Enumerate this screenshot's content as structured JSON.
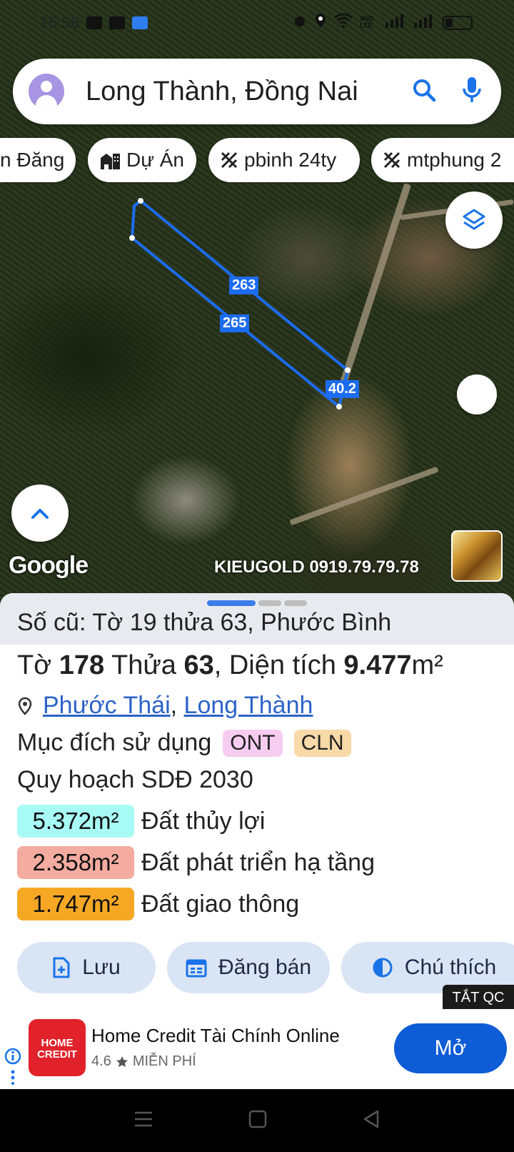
{
  "status_bar": {
    "time": "15:56",
    "network_label": "VoD LTE"
  },
  "search": {
    "query": "Long Thành, Đồng Nai"
  },
  "chips": [
    {
      "label": "n Đăng",
      "icon": ""
    },
    {
      "label": "Dự Án",
      "icon": "buildings-icon"
    },
    {
      "label": "pbinh 24ty",
      "icon": "pattern-icon"
    },
    {
      "label": "mtphung 2",
      "icon": "pattern-icon"
    }
  ],
  "map": {
    "edge_labels": [
      "263",
      "265",
      "40.2"
    ],
    "google_logo": "Google",
    "watermark": "KIEUGOLD 0919.79.79.78",
    "polygon_color": "#1c6cf0"
  },
  "parcel": {
    "old_info": "Số cũ: Tờ 19 thửa 63, Phước Bình",
    "title": {
      "sheet_label": "Tờ ",
      "sheet_number": "178",
      "plot_label": " Thửa ",
      "plot_number": "63",
      "area_label": ", Diện tích ",
      "area_value": "9.477",
      "area_unit": "m²"
    },
    "location": {
      "ward": "Phước Thái",
      "separator": ", ",
      "district": "Long Thành"
    },
    "purpose_label": "Mục đích sử dụng",
    "purpose_tags": [
      {
        "code": "ONT",
        "color": "#f6cdf1"
      },
      {
        "code": "CLN",
        "color": "#f8d9a8"
      }
    ],
    "plan_label": "Quy hoạch SDĐ 2030",
    "plan_items": [
      {
        "area": "5.372m²",
        "label": "Đất thủy lợi",
        "color": "#a8fbf5"
      },
      {
        "area": "2.358m²",
        "label": "Đất phát triển hạ tầng",
        "color": "#f4aba0"
      },
      {
        "area": "1.747m²",
        "label": "Đất giao thông",
        "color": "#f6a825"
      }
    ]
  },
  "actions": {
    "save": "Lưu",
    "post": "Đăng bán",
    "legend": "Chú thích"
  },
  "ad": {
    "close_label": "TẮT QC",
    "logo_text_1": "HOME",
    "logo_text_2": "CREDIT",
    "title": "Home Credit Tài Chính Online",
    "rating": "4.6",
    "price": "MIỄN PHÍ",
    "open_label": "Mở"
  }
}
